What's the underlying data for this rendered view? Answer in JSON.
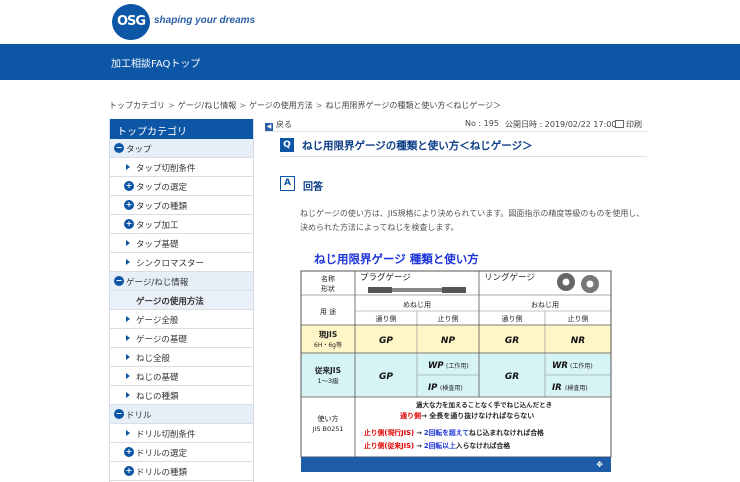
{
  "header": {
    "logo_text": "OSG",
    "tagline": "shaping your dreams"
  },
  "banner": {
    "title": "加工相談FAQトップ"
  },
  "breadcrumb": [
    "トップカテゴリ",
    "ゲージ/ねじ情報",
    "ゲージの使用方法",
    "ねじ用限界ゲージの種類と使い方＜ねじゲージ＞"
  ],
  "sidebar": {
    "title": "トップカテゴリ",
    "items": [
      {
        "label": "タップ",
        "type": "cat",
        "icon": "−"
      },
      {
        "label": "タップ切削条件",
        "type": "child",
        "icon": "tri"
      },
      {
        "label": "タップの選定",
        "type": "child",
        "icon": "+"
      },
      {
        "label": "タップの種類",
        "type": "child",
        "icon": "+"
      },
      {
        "label": "タップ加工",
        "type": "child",
        "icon": "+"
      },
      {
        "label": "タップ基礎",
        "type": "child",
        "icon": "tri"
      },
      {
        "label": "シンクロマスター",
        "type": "child",
        "icon": "tri"
      },
      {
        "label": "ゲージ/ねじ情報",
        "type": "cat",
        "icon": "−"
      },
      {
        "label": "ゲージの使用方法",
        "type": "selected",
        "icon": ""
      },
      {
        "label": "ゲージ全般",
        "type": "child",
        "icon": "tri"
      },
      {
        "label": "ゲージの基礎",
        "type": "child",
        "icon": "tri"
      },
      {
        "label": "ねじ全般",
        "type": "child",
        "icon": "tri"
      },
      {
        "label": "ねじの基礎",
        "type": "child",
        "icon": "tri"
      },
      {
        "label": "ねじの種類",
        "type": "child",
        "icon": "tri"
      },
      {
        "label": "ドリル",
        "type": "cat",
        "icon": "−"
      },
      {
        "label": "ドリル切削条件",
        "type": "child",
        "icon": "tri"
      },
      {
        "label": "ドリルの選定",
        "type": "child",
        "icon": "+"
      },
      {
        "label": "ドリルの種類",
        "type": "child",
        "icon": "+"
      }
    ]
  },
  "toolbar": {
    "back_label": "戻る",
    "no_label": "No : 195",
    "date_label": "公開日時 : 2019/02/22 17:00",
    "print_label": "印刷"
  },
  "question": {
    "badge": "Q",
    "title": "ねじ用限界ゲージの種類と使い方＜ねじゲージ＞"
  },
  "answer": {
    "badge": "A",
    "title": "回答",
    "text": "ねじゲージの使い方は、JIS規格により決められています。図面指示の精度等級のものを使用し、決められた方法によってねじを検査します。"
  },
  "figure": {
    "title": "ねじ用限界ゲージ 種類と使い方",
    "hdr_name": "名称",
    "hdr_shape": "形状",
    "plug": "プラグゲージ",
    "ring": "リングゲージ",
    "use": "用 途",
    "female": "めねじ用",
    "male": "おねじ用",
    "go": "通り側",
    "nogo": "止り側",
    "current_jis": "現JIS",
    "current_grade": "6H・6g等",
    "old_jis": "従来JIS",
    "old_grade": "1〜3級",
    "gp": "GP",
    "np": "NP",
    "gr": "GR",
    "nr": "NR",
    "wp": "WP",
    "wp_note": "(工作用)",
    "ip": "IP",
    "ip_note": "(検査用)",
    "wr": "WR",
    "wr_note": "(工作用)",
    "ir": "IR",
    "ir_note": "(検査用)",
    "usage_label": "使い方",
    "usage_std": "JIS B0251",
    "usage_line1": "過大な力を加えることなく手でねじ込んだとき",
    "usage_line2_red": "通り側",
    "usage_line2_rest": "→ 全長を通り抜けなければならない",
    "usage_line3_red": "止り側(現行JIS)",
    "usage_line3_arrow": "→",
    "usage_line3_blue": "2回転を超えて",
    "usage_line3_rest": "ねじ込まれなければ合格",
    "usage_line4_red": "止り側(従来JIS)",
    "usage_line4_arrow": "→",
    "usage_line4_blue": "2回転以上",
    "usage_line4_rest": "入らなければ合格"
  },
  "colors": {
    "brand_blue": "#0d56a6",
    "current_row": "#fff6c8",
    "old_row": "#d6f3f6",
    "red_text": "#e00000",
    "blue_text": "#1d35d8"
  }
}
